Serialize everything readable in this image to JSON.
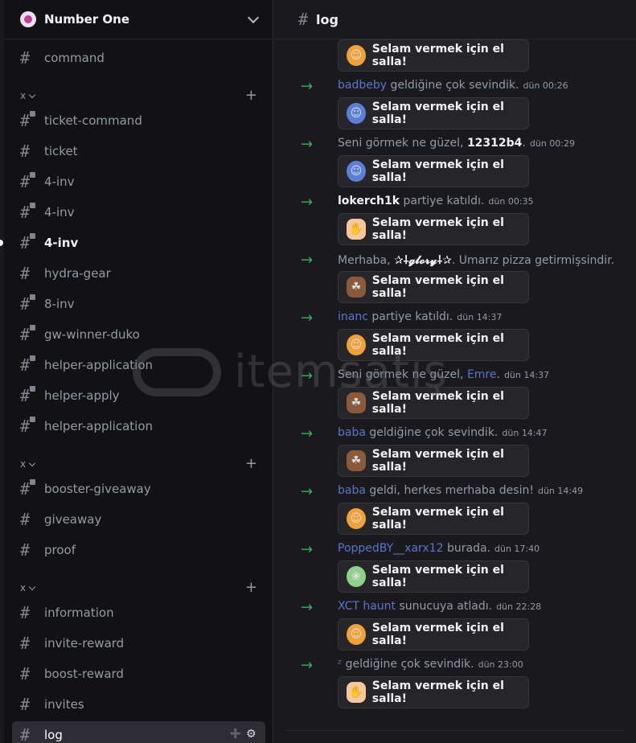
{
  "server": {
    "name": "Number One"
  },
  "channel_header": {
    "title": "log"
  },
  "sidebar": {
    "channels_top": [
      {
        "name": "command",
        "locked": false
      }
    ],
    "categories": [
      {
        "label": "x"
      },
      {
        "label": "x"
      },
      {
        "label": "x"
      }
    ],
    "group1": [
      {
        "name": "ticket-command",
        "locked": true
      },
      {
        "name": "ticket",
        "locked": false
      },
      {
        "name": "4-inv",
        "locked": true
      },
      {
        "name": "4-inv",
        "locked": true
      },
      {
        "name": "4-inv",
        "locked": true
      },
      {
        "name": "hydra-gear",
        "locked": false
      },
      {
        "name": "8-inv",
        "locked": true
      },
      {
        "name": "gw-winner-duko",
        "locked": true
      },
      {
        "name": "helper-application",
        "locked": true
      },
      {
        "name": "helper-apply",
        "locked": true
      },
      {
        "name": "helper-application",
        "locked": true
      }
    ],
    "group2": [
      {
        "name": "booster-giveaway",
        "locked": true
      },
      {
        "name": "giveaway",
        "locked": false
      },
      {
        "name": "proof",
        "locked": false
      }
    ],
    "group3": [
      {
        "name": "information",
        "locked": false
      },
      {
        "name": "invite-reward",
        "locked": false
      },
      {
        "name": "boost-reward",
        "locked": false
      },
      {
        "name": "invites",
        "locked": false
      },
      {
        "name": "log",
        "locked": false
      }
    ]
  },
  "messages": [
    {
      "pre": "",
      "user": "badbeby",
      "post": " geldiğine çok sevindik.",
      "ts": "dün 00:26"
    },
    {
      "pre": "Seni görmek ne güzel, ",
      "user": "12312b4",
      "post": ".",
      "ts": "dün 00:29"
    },
    {
      "pre": "",
      "user": "lokerch1k",
      "post": " partiye katıldı.",
      "ts": "dün 00:35"
    },
    {
      "pre": "Merhaba, ",
      "user": "✰⸸𝓰𝓵𝓸𝓻𝔂⸸✰",
      "post": ". Umarız pizza getirmişsindir.",
      "ts": ""
    },
    {
      "pre": "",
      "user": "inanc",
      "post": " partiye katıldı.",
      "ts": "dün 14:37"
    },
    {
      "pre": "Seni görmek ne güzel, ",
      "user": "Emre",
      "post": ".",
      "ts": "dün 14:37"
    },
    {
      "pre": "",
      "user": "baba",
      "post": " geldiğine çok sevindik.",
      "ts": "dün 14:47"
    },
    {
      "pre": "",
      "user": "baba",
      "post": " geldi, herkes merhaba desin!",
      "ts": "dün 14:49"
    },
    {
      "pre": "",
      "user": "PoppedBY__xarx12",
      "post": " burada.",
      "ts": "dün 17:40"
    },
    {
      "pre": "",
      "user": "XCT haunt",
      "post": " sunucuya atladı.",
      "ts": "dün 22:28"
    },
    {
      "pre": "",
      "user": "ᶻ",
      "post": " geldiğine çok sevindik.",
      "ts": "dün 23:00"
    }
  ],
  "wave_button": {
    "label": "Selam vermek için el salla!"
  },
  "stickers": [
    "robot",
    "robot-blue",
    "robot-blue",
    "hand",
    "sup",
    "robot",
    "sup",
    "sup",
    "robot",
    "bird",
    "robot",
    "hand"
  ],
  "watermark": {
    "text": "itemsatış"
  },
  "colors": {
    "accent_arrow": "#3ba55c",
    "username": "#5a75c8",
    "selected_bg": "#2d2d33"
  }
}
